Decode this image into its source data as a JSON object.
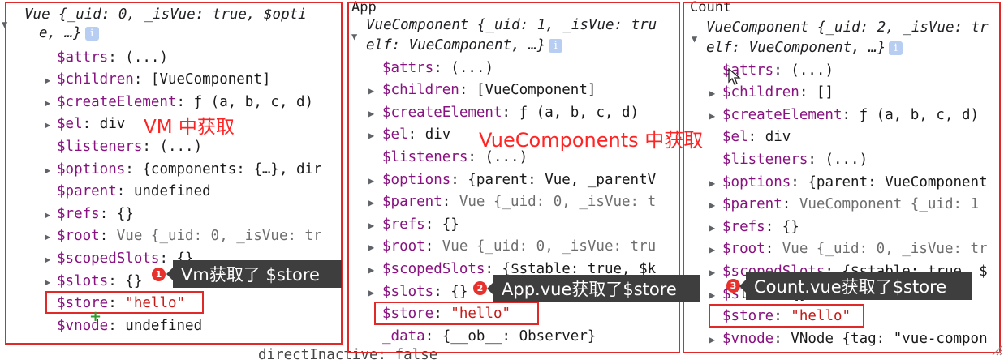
{
  "panels": [
    {
      "title": "",
      "header_line1": "Vue {_uid: 0, _isVue: true, $opti",
      "header_line2": "e, …}",
      "rows": [
        {
          "tri": "",
          "key": "$attrs",
          "val": "(...)",
          "style": "v"
        },
        {
          "tri": "▶",
          "key": "$children",
          "val": "[VueComponent]",
          "style": "v"
        },
        {
          "tri": "▶",
          "key": "$createElement",
          "val": "ƒ (a, b, c, d)",
          "style": "v"
        },
        {
          "tri": "▶",
          "key": "$el",
          "val": "div",
          "style": "v"
        },
        {
          "tri": "",
          "key": "$listeners",
          "val": "(...)",
          "style": "v"
        },
        {
          "tri": "▶",
          "key": "$options",
          "val": "{components: {…}, dir",
          "style": "v"
        },
        {
          "tri": "",
          "key": "$parent",
          "val": "undefined",
          "style": "v"
        },
        {
          "tri": "▶",
          "key": "$refs",
          "val": "{}",
          "style": "v"
        },
        {
          "tri": "▶",
          "key": "$root",
          "val": "Vue {_uid: 0, _isVue: tr",
          "style": "gray"
        },
        {
          "tri": "▶",
          "key": "$scopedSlots",
          "val": "{}",
          "style": "v"
        },
        {
          "tri": "▶",
          "key": "$slots",
          "val": "{}",
          "style": "v"
        },
        {
          "tri": "",
          "key": "$store",
          "val": "\"hello\"",
          "style": "str"
        },
        {
          "tri": "",
          "key": "$vnode",
          "val": "undefined",
          "style": "v"
        }
      ]
    },
    {
      "title": "App",
      "header_line1": "VueComponent {_uid: 1, _isVue: tru",
      "header_line2": "elf: VueComponent, …}",
      "rows": [
        {
          "tri": "",
          "key": "$attrs",
          "val": "(...)",
          "style": "v"
        },
        {
          "tri": "▶",
          "key": "$children",
          "val": "[VueComponent]",
          "style": "v"
        },
        {
          "tri": "▶",
          "key": "$createElement",
          "val": "ƒ (a, b, c, d)",
          "style": "v"
        },
        {
          "tri": "▶",
          "key": "$el",
          "val": "div",
          "style": "v"
        },
        {
          "tri": "",
          "key": "$listeners",
          "val": "(...)",
          "style": "v"
        },
        {
          "tri": "▶",
          "key": "$options",
          "val": "{parent: Vue, _parentV",
          "style": "v"
        },
        {
          "tri": "▶",
          "key": "$parent",
          "val": "Vue {_uid: 0, _isVue: t",
          "style": "gray"
        },
        {
          "tri": "▶",
          "key": "$refs",
          "val": "{}",
          "style": "v"
        },
        {
          "tri": "▶",
          "key": "$root",
          "val": "Vue {_uid: 0, _isVue: tru",
          "style": "gray"
        },
        {
          "tri": "▶",
          "key": "$scopedSlots",
          "val": "{$stable: true, $k",
          "style": "v"
        },
        {
          "tri": "▶",
          "key": "$slots",
          "val": "{}",
          "style": "v"
        },
        {
          "tri": "",
          "key": "$store",
          "val": "\"hello\"",
          "style": "str"
        },
        {
          "tri": "",
          "key": "_data",
          "val": "{__ob__: Observer}",
          "style": "v"
        }
      ]
    },
    {
      "title": "Count",
      "header_line1": "VueComponent {_uid: 2, _isVue: tr",
      "header_line2": "elf: VueComponent, …}",
      "rows": [
        {
          "tri": "",
          "key": "$attrs",
          "val": "(...)",
          "style": "v"
        },
        {
          "tri": "▶",
          "key": "$children",
          "val": "[]",
          "style": "v"
        },
        {
          "tri": "▶",
          "key": "$createElement",
          "val": "ƒ (a, b, c, d)",
          "style": "v"
        },
        {
          "tri": "",
          "key": "$el",
          "val": "div",
          "style": "v"
        },
        {
          "tri": "",
          "key": "$listeners",
          "val": "(...)",
          "style": "v"
        },
        {
          "tri": "▶",
          "key": "$options",
          "val": "{parent: VueComponent",
          "style": "v"
        },
        {
          "tri": "▶",
          "key": "$parent",
          "val": "VueComponent {_uid: 1",
          "style": "gray"
        },
        {
          "tri": "▶",
          "key": "$refs",
          "val": "{}",
          "style": "v"
        },
        {
          "tri": "▶",
          "key": "$root",
          "val": "Vue {_uid: 0, _isVue: tr",
          "style": "gray"
        },
        {
          "tri": "▶",
          "key": "$scopedSlots",
          "val": "{$stable: true, $",
          "style": "v"
        },
        {
          "tri": "▶",
          "key": "$slots",
          "val": "{}",
          "style": "v"
        },
        {
          "tri": "",
          "key": "$store",
          "val": "\"hello\"",
          "style": "str"
        },
        {
          "tri": "▶",
          "key": "$vnode",
          "val": "VNode {tag: \"vue-compon",
          "style": "v"
        }
      ]
    }
  ],
  "bottom_text": "directInactive: false",
  "annotations": {
    "vm_label": "VM 中获取",
    "vc_label": "VueComponents 中获取",
    "tip1": "Vm获取了 $store",
    "tip2": "App.vue获取了$store",
    "tip3": "Count.vue获取了$store",
    "badge1": "1",
    "badge2": "2",
    "badge3": "3"
  },
  "colors": {
    "key": "#881280",
    "string": "#c41a16",
    "annotation_red": "#ff2424",
    "box_red": "#e02a2a",
    "tooltip_bg": "#3e3e3e"
  }
}
